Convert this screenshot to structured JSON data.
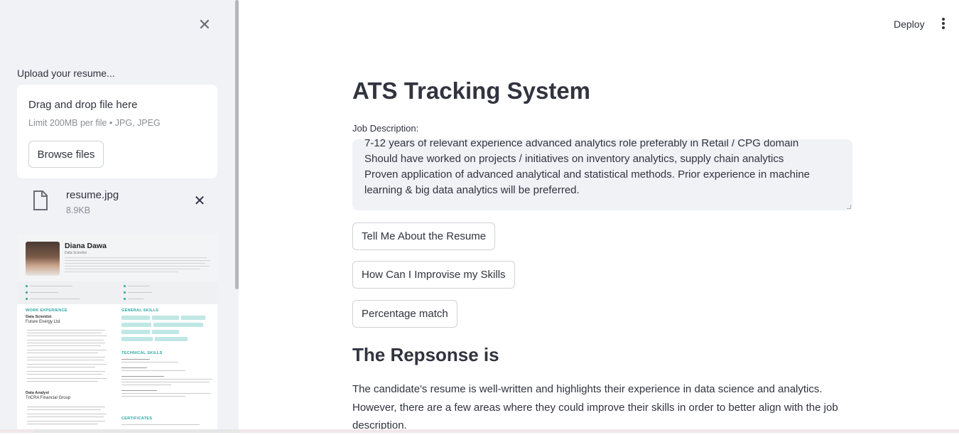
{
  "sidebar": {
    "upload_label": "Upload your resume...",
    "dropzone": {
      "title": "Drag and drop file here",
      "subtitle": "Limit 200MB per file • JPG, JPEG",
      "browse_label": "Browse files"
    },
    "file": {
      "name": "resume.jpg",
      "size": "8.9KB"
    },
    "resume_preview": {
      "name": "Diana Dawa",
      "role": "Data Scientist",
      "sections": {
        "work": "WORK EXPERIENCE",
        "general_skills": "GENERAL SKILLS",
        "technical_skills": "TECHNICAL SKILLS",
        "certificates": "CERTIFICATES"
      },
      "job1_title": "Data Scientist",
      "job1_company": "Future Energy Ltd.",
      "job2_title": "Data Analyst",
      "job2_company": "TriCRA Financial Group"
    }
  },
  "header": {
    "deploy_label": "Deploy"
  },
  "main": {
    "title": "ATS Tracking System",
    "job_description_label": "Job Description:",
    "job_description_value": "7-12 years of relevant experience advanced analytics role preferably in Retail / CPG domain\nShould have worked on projects / initiatives on inventory analytics, supply chain analytics\nProven application of advanced analytical and statistical methods. Prior experience in machine learning & big data analytics will be preferred.",
    "buttons": {
      "tell_me": "Tell Me About the Resume",
      "improvise": "How Can I Improvise my Skills",
      "percentage": "Percentage match"
    },
    "response_heading": "The Repsonse is",
    "response_text": "The candidate's resume is well-written and highlights their experience in data science and analytics. However, there are a few areas where they could improve their skills in order to better align with the job description."
  }
}
